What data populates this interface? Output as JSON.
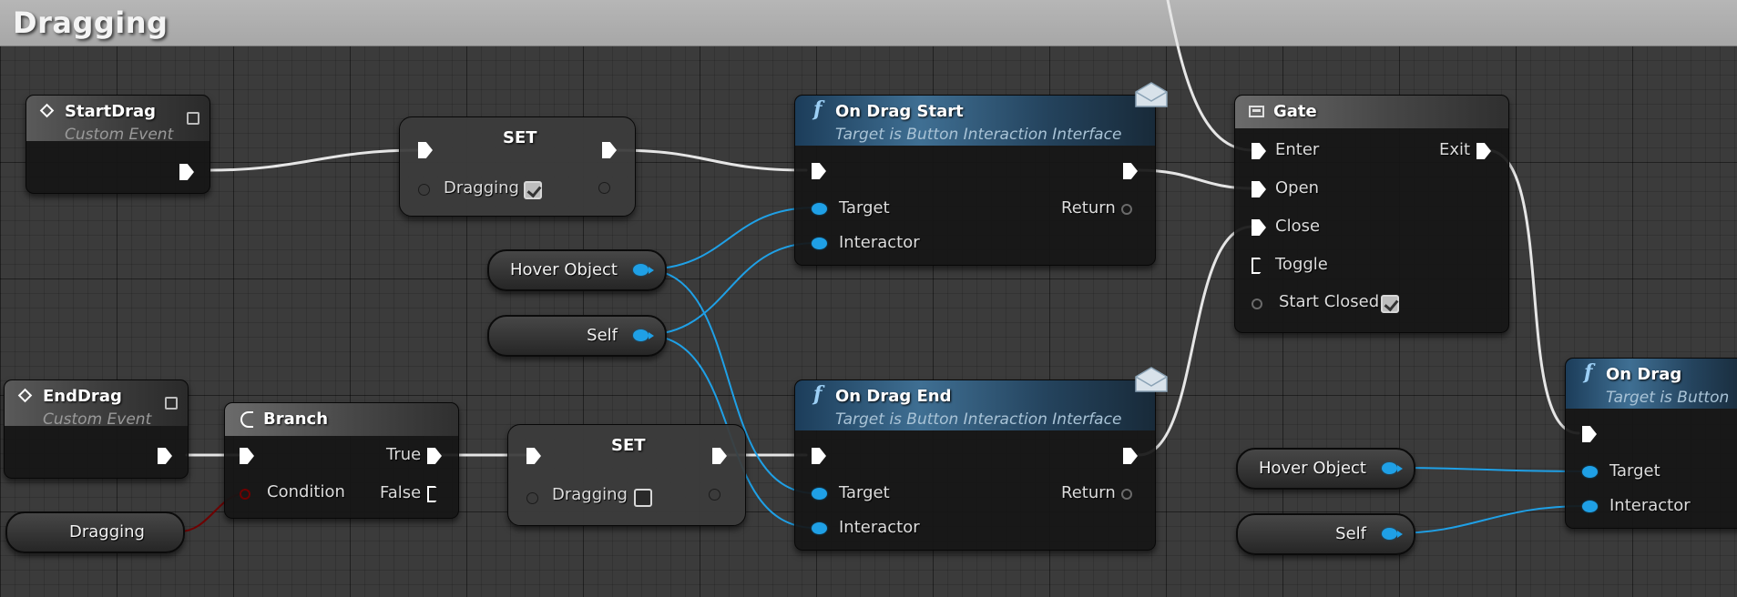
{
  "graph": {
    "title": "Dragging"
  },
  "colors": {
    "exec_wire": "#e6e6e6",
    "object_wire": "#1fa0e6",
    "bool_wire": "#6e0000",
    "header_func": "#3f6f93"
  },
  "nodes": {
    "start_drag": {
      "title": "StartDrag",
      "subtitle": "Custom Event",
      "icon": "diamond-icon"
    },
    "set_true": {
      "title": "SET",
      "var_label": "Dragging",
      "value": true
    },
    "on_drag_start": {
      "title": "On Drag Start",
      "subtitle": "Target is Button Interaction Interface",
      "icon": "function-icon",
      "target_label": "Target",
      "interactor_label": "Interactor",
      "return_label": "Return"
    },
    "gate": {
      "title": "Gate",
      "icon": "gate-icon",
      "enter_label": "Enter",
      "open_label": "Open",
      "close_label": "Close",
      "toggle_label": "Toggle",
      "start_closed_label": "Start Closed",
      "start_closed_value": true,
      "exit_label": "Exit"
    },
    "end_drag": {
      "title": "EndDrag",
      "subtitle": "Custom Event",
      "icon": "diamond-icon"
    },
    "branch": {
      "title": "Branch",
      "icon": "branch-icon",
      "condition_label": "Condition",
      "true_label": "True",
      "false_label": "False"
    },
    "set_false": {
      "title": "SET",
      "var_label": "Dragging",
      "value": false
    },
    "on_drag_end": {
      "title": "On Drag End",
      "subtitle": "Target is Button Interaction Interface",
      "icon": "function-icon",
      "target_label": "Target",
      "interactor_label": "Interactor",
      "return_label": "Return"
    },
    "on_drag": {
      "title": "On Drag",
      "subtitle": "Target is Button",
      "icon": "function-icon",
      "target_label": "Target",
      "interactor_label": "Interactor"
    }
  },
  "variables": {
    "hover_object_1": "Hover Object",
    "self_1": "Self",
    "dragging_get": "Dragging",
    "hover_object_2": "Hover Object",
    "self_2": "Self"
  }
}
